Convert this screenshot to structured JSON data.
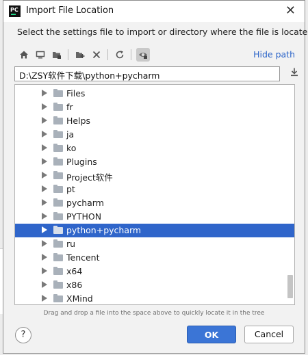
{
  "window": {
    "app_icon_label": "PC",
    "title": "Import File Location",
    "close_glyph": "✕"
  },
  "description": "Select the settings file to import or directory where the file is located",
  "toolbar": {
    "icons": [
      "home-icon",
      "desktop-icon",
      "project-folder-icon",
      "new-folder-icon",
      "delete-icon",
      "refresh-icon",
      "show-hidden-icon"
    ],
    "hide_path_label": "Hide path"
  },
  "path_input": {
    "value": "D:\\ZSY软件下载\\python+pycharm"
  },
  "tree": {
    "items": [
      {
        "label": "Files",
        "selected": false
      },
      {
        "label": "fr",
        "selected": false
      },
      {
        "label": "Helps",
        "selected": false
      },
      {
        "label": "ja",
        "selected": false
      },
      {
        "label": "ko",
        "selected": false
      },
      {
        "label": "Plugins",
        "selected": false
      },
      {
        "label": "Project软件",
        "selected": false
      },
      {
        "label": "pt",
        "selected": false
      },
      {
        "label": "pycharm",
        "selected": false
      },
      {
        "label": "PYTHON",
        "selected": false
      },
      {
        "label": "python+pycharm",
        "selected": true
      },
      {
        "label": "ru",
        "selected": false
      },
      {
        "label": "Tencent",
        "selected": false
      },
      {
        "label": "x64",
        "selected": false
      },
      {
        "label": "x86",
        "selected": false
      },
      {
        "label": "XMind",
        "selected": false
      }
    ]
  },
  "hint": "Drag and drop a file into the space above to quickly locate it in the tree",
  "buttons": {
    "help": "?",
    "ok": "OK",
    "cancel": "Cancel"
  },
  "colors": {
    "accent": "#3b75d6",
    "selection": "#2f65ca",
    "link": "#2862c8"
  }
}
